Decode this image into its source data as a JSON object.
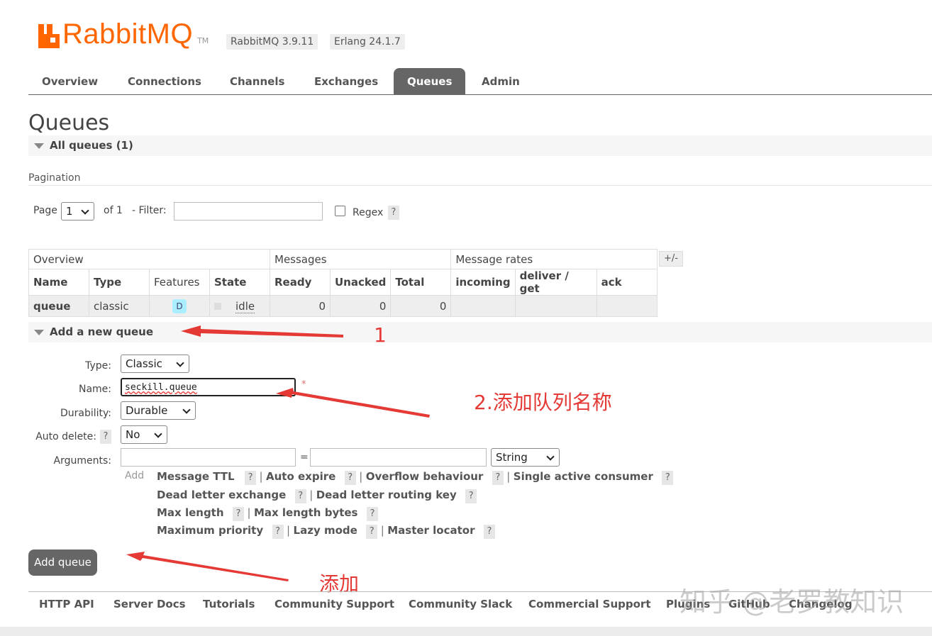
{
  "header": {
    "logo_text": "RabbitMQ",
    "logo_tm": "TM",
    "version": "RabbitMQ 3.9.11",
    "erlang": "Erlang 24.1.7"
  },
  "tabs": [
    "Overview",
    "Connections",
    "Channels",
    "Exchanges",
    "Queues",
    "Admin"
  ],
  "active_tab": "Queues",
  "page_title": "Queues",
  "all_queues": "All queues (1)",
  "pagination": {
    "label": "Pagination",
    "page_label": "Page",
    "page_value": "1",
    "of_label": "of 1",
    "filter_label": "- Filter:",
    "filter_value": "",
    "regex_label": "Regex",
    "help": "?"
  },
  "table": {
    "groups": [
      "Overview",
      "Messages",
      "Message rates"
    ],
    "toggle": "+/-",
    "columns": [
      "Name",
      "Type",
      "Features",
      "State",
      "Ready",
      "Unacked",
      "Total",
      "incoming",
      "deliver / get",
      "ack"
    ],
    "rows": [
      {
        "name": "queue",
        "type": "classic",
        "feature": "D",
        "state": "idle",
        "ready": "0",
        "unacked": "0",
        "total": "0",
        "incoming": "",
        "deliver_get": "",
        "ack": ""
      }
    ]
  },
  "add_queue": {
    "section_title": "Add a new queue",
    "type_label": "Type:",
    "type_value": "Classic",
    "name_label": "Name:",
    "name_value": "seckill.queue",
    "required_mark": "*",
    "durability_label": "Durability:",
    "durability_value": "Durable",
    "auto_delete_label": "Auto delete:",
    "auto_delete_value": "No",
    "arguments_label": "Arguments:",
    "arg_key": "",
    "equals": "=",
    "arg_value": "",
    "arg_type": "String",
    "add_label": "Add",
    "arg_links": [
      [
        "Message TTL",
        "Auto expire",
        "Overflow behaviour",
        "Single active consumer"
      ],
      [
        "Dead letter exchange",
        "Dead letter routing key"
      ],
      [
        "Max length",
        "Max length bytes"
      ],
      [
        "Maximum priority",
        "Lazy mode",
        "Master locator"
      ]
    ],
    "submit": "Add queue"
  },
  "footer": [
    "HTTP API",
    "Server Docs",
    "Tutorials",
    "Community Support",
    "Community Slack",
    "Commercial Support",
    "Plugins",
    "GitHub",
    "Changelog"
  ],
  "annotations": {
    "step1": "1",
    "step2": "2.添加队列名称",
    "step3": "添加",
    "color": "#e53935"
  },
  "watermark": "知乎 @老罗教知识"
}
